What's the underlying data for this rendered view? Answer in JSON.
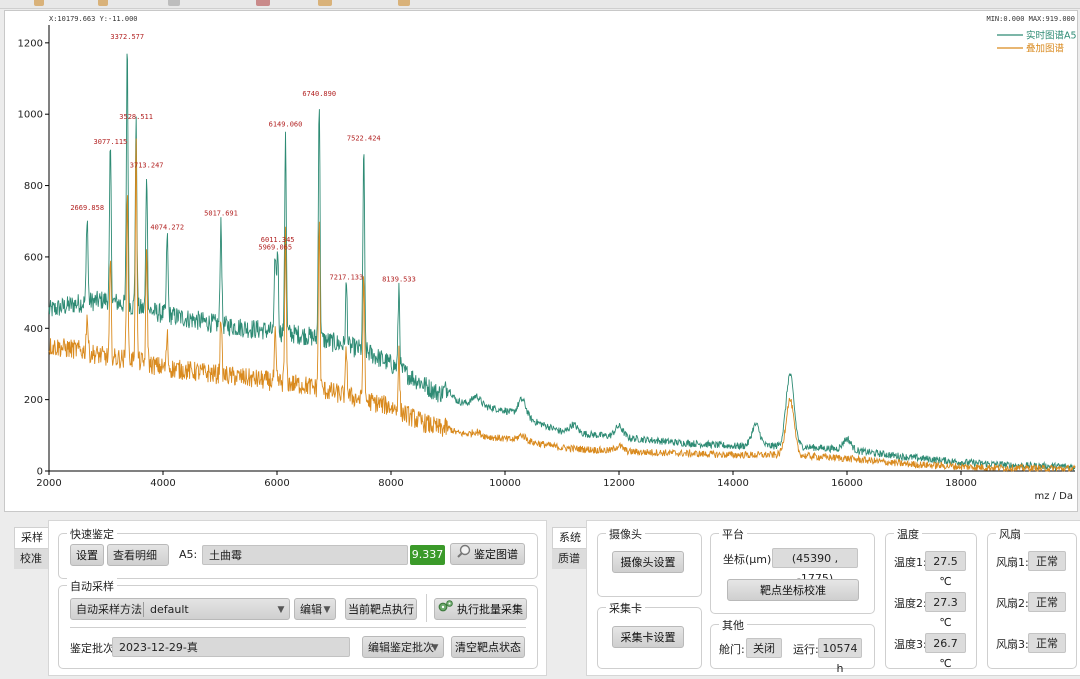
{
  "chart": {
    "readout_left": "X:10179.663  Y:-11.000",
    "readout_right": "MIN:0.000  MAX:919.000",
    "x_unit": "mz / Da"
  },
  "chart_data": {
    "type": "line",
    "xlim": [
      2000,
      20000
    ],
    "ylim": [
      0,
      1250
    ],
    "x_ticks": [
      "2000",
      "4000",
      "6000",
      "8000",
      "10000",
      "12000",
      "14000",
      "16000",
      "18000"
    ],
    "y_ticks": [
      "0",
      "200",
      "400",
      "600",
      "800",
      "1000",
      "1200"
    ],
    "xlabel": "mz / Da",
    "series": [
      {
        "name": "实时图谱A5",
        "color": "#2e8b74",
        "baseline": [
          [
            2000,
            450
          ],
          [
            2500,
            470
          ],
          [
            3000,
            480
          ],
          [
            3500,
            460
          ],
          [
            4000,
            440
          ],
          [
            5000,
            410
          ],
          [
            6000,
            390
          ],
          [
            6500,
            380
          ],
          [
            7000,
            360
          ],
          [
            7500,
            340
          ],
          [
            8000,
            300
          ],
          [
            8500,
            250
          ],
          [
            9000,
            200
          ],
          [
            10000,
            170
          ],
          [
            10500,
            140
          ],
          [
            11000,
            110
          ],
          [
            12000,
            95
          ],
          [
            13000,
            80
          ],
          [
            14000,
            70
          ],
          [
            15000,
            70
          ],
          [
            16000,
            60
          ],
          [
            17000,
            40
          ],
          [
            18000,
            25
          ],
          [
            19000,
            15
          ],
          [
            20000,
            12
          ]
        ],
        "peaks": [
          [
            2669,
            720
          ],
          [
            3077,
            905
          ],
          [
            3372,
            1200
          ],
          [
            3528,
            975
          ],
          [
            3713,
            840
          ],
          [
            4074,
            665
          ],
          [
            5017,
            705
          ],
          [
            5969,
            610
          ],
          [
            6011,
            630
          ],
          [
            6149,
            955
          ],
          [
            6740,
            1040
          ],
          [
            7217,
            525
          ],
          [
            7522,
            915
          ],
          [
            8139,
            520
          ],
          [
            9000,
            230
          ],
          [
            9500,
            210
          ],
          [
            10300,
            200
          ],
          [
            11200,
            130
          ],
          [
            12000,
            125
          ],
          [
            14400,
            130
          ],
          [
            15000,
            270
          ],
          [
            16000,
            90
          ]
        ]
      },
      {
        "name": "叠加图谱",
        "color": "#d98a1e",
        "baseline": [
          [
            2000,
            350
          ],
          [
            2500,
            340
          ],
          [
            3000,
            320
          ],
          [
            3500,
            310
          ],
          [
            4000,
            290
          ],
          [
            5000,
            270
          ],
          [
            6000,
            250
          ],
          [
            6500,
            240
          ],
          [
            7000,
            220
          ],
          [
            7500,
            200
          ],
          [
            8000,
            180
          ],
          [
            8500,
            140
          ],
          [
            9000,
            110
          ],
          [
            10000,
            90
          ],
          [
            10500,
            80
          ],
          [
            11000,
            65
          ],
          [
            12000,
            55
          ],
          [
            13000,
            50
          ],
          [
            14000,
            45
          ],
          [
            15000,
            45
          ],
          [
            16000,
            35
          ],
          [
            17000,
            20
          ],
          [
            18000,
            12
          ],
          [
            19000,
            8
          ],
          [
            20000,
            6
          ]
        ],
        "peaks": [
          [
            2669,
            440
          ],
          [
            3077,
            580
          ],
          [
            3372,
            790
          ],
          [
            3528,
            920
          ],
          [
            3713,
            610
          ],
          [
            4074,
            380
          ],
          [
            5017,
            440
          ],
          [
            5969,
            380
          ],
          [
            6149,
            660
          ],
          [
            6740,
            690
          ],
          [
            7217,
            340
          ],
          [
            7522,
            560
          ],
          [
            8139,
            330
          ],
          [
            9000,
            120
          ],
          [
            9500,
            110
          ],
          [
            10300,
            100
          ],
          [
            12000,
            70
          ],
          [
            15000,
            200
          ]
        ]
      }
    ],
    "annotations": [
      {
        "x": 2669.858,
        "y": 720,
        "label": "2669.858"
      },
      {
        "x": 3077.115,
        "y": 905,
        "label": "3077.115"
      },
      {
        "x": 3372.577,
        "y": 1200,
        "label": "3372.577"
      },
      {
        "x": 3528.511,
        "y": 975,
        "label": "3528.511"
      },
      {
        "x": 3713.247,
        "y": 840,
        "label": "3713.247"
      },
      {
        "x": 4074.272,
        "y": 665,
        "label": "4074.272"
      },
      {
        "x": 5017.691,
        "y": 705,
        "label": "5017.691"
      },
      {
        "x": 6011.345,
        "y": 630,
        "label": "6011.345"
      },
      {
        "x": 5969.065,
        "y": 610,
        "label": "5969.065"
      },
      {
        "x": 6149.06,
        "y": 955,
        "label": "6149.060"
      },
      {
        "x": 6740.89,
        "y": 1040,
        "label": "6740.890"
      },
      {
        "x": 7217.133,
        "y": 525,
        "label": "7217.133"
      },
      {
        "x": 7522.424,
        "y": 915,
        "label": "7522.424"
      },
      {
        "x": 8139.533,
        "y": 520,
        "label": "8139.533"
      }
    ],
    "legend_position": "top-right"
  },
  "left_tabs": {
    "items": [
      {
        "label": "采样"
      },
      {
        "label": "校准"
      }
    ]
  },
  "quick_id": {
    "title": "快速鉴定",
    "settings_button": "设置",
    "detail_combo": "查看明细",
    "sample_label": "A5:",
    "sample_value": "土曲霉",
    "score": "9.337",
    "score_color": "#3b9a2a",
    "identify_button": "鉴定图谱"
  },
  "auto_sampling": {
    "title": "自动采样",
    "method_combo": "自动采样方法",
    "method_value": "default",
    "edit_combo": "编辑",
    "run_current_button": "当前靶点执行",
    "run_batch_button": "执行批量采集",
    "batch_label": "鉴定批次:",
    "batch_value": "2023-12-29-真",
    "edit_batch_combo": "编辑鉴定批次",
    "clear_button": "清空靶点状态"
  },
  "right_tabs": {
    "items": [
      {
        "label": "系统"
      },
      {
        "label": "质谱"
      }
    ]
  },
  "camera": {
    "title": "摄像头",
    "button": "摄像头设置"
  },
  "capture_card": {
    "title": "采集卡",
    "button": "采集卡设置"
  },
  "platform": {
    "title": "平台",
    "coord_label": "坐标(μm):",
    "coord_value": "(45390 ,  -1775)",
    "calib_button": "靶点坐标校准"
  },
  "other": {
    "title": "其他",
    "door_label": "舱门:",
    "door_value": "关闭",
    "run_label": "运行:",
    "run_value": "10574 h"
  },
  "temperature": {
    "title": "温度",
    "items": [
      {
        "label": "温度1:",
        "value": "27.5 ℃"
      },
      {
        "label": "温度2:",
        "value": "27.3 ℃"
      },
      {
        "label": "温度3:",
        "value": "26.7 ℃"
      }
    ]
  },
  "fan": {
    "title": "风扇",
    "items": [
      {
        "label": "风扇1:",
        "value": "正常"
      },
      {
        "label": "风扇2:",
        "value": "正常"
      },
      {
        "label": "风扇3:",
        "value": "正常"
      }
    ]
  }
}
